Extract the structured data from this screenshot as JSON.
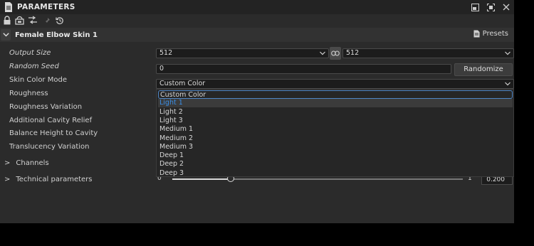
{
  "window": {
    "title": "PARAMETERS"
  },
  "header": {
    "title": "Female Elbow Skin 1",
    "presets_label": "Presets"
  },
  "params": {
    "output_size": {
      "label": "Output Size",
      "width_value": "512",
      "height_value": "512"
    },
    "random_seed": {
      "label": "Random Seed",
      "value": "0",
      "button_label": "Randomize"
    },
    "skin_color_mode": {
      "label": "Skin Color Mode",
      "value": "Custom Color"
    },
    "roughness": {
      "label": "Roughness"
    },
    "roughness_variation": {
      "label": "Roughness Variation"
    },
    "additional_cavity_relief": {
      "label": "Additional Cavity Relief"
    },
    "balance_height_to_cavity": {
      "label": "Balance Height to Cavity"
    },
    "translucency_variation": {
      "label": "Translucency Variation"
    }
  },
  "groups": {
    "channels": {
      "label": "Channels",
      "chevron": ">"
    },
    "technical": {
      "label": "Technical parameters",
      "chevron": ">"
    }
  },
  "dropdown": {
    "options": [
      "Custom Color",
      "Light 1",
      "Light 2",
      "Light 3",
      "Medium 1",
      "Medium 2",
      "Medium 3",
      "Deep 1",
      "Deep 2",
      "Deep 3"
    ],
    "selected": "Custom Color",
    "hovered": "Light 1"
  },
  "slider": {
    "min_label": "0",
    "max_label": "1",
    "value_text": "0.200",
    "value": 0.2
  },
  "icons": [
    "document-icon",
    "lock-icon",
    "reset-to-default-icon",
    "link-parameters-icon",
    "pin-icon",
    "history-icon",
    "dock-icon",
    "maximize-icon",
    "close-icon",
    "chevron-down-icon",
    "presets-icon",
    "chain-link-icon"
  ],
  "colors": {
    "panel_bg": "#2b2b2b",
    "titlebar_bg": "#232323",
    "accent": "#4f86c6",
    "hover_text": "#3a8ee6"
  }
}
